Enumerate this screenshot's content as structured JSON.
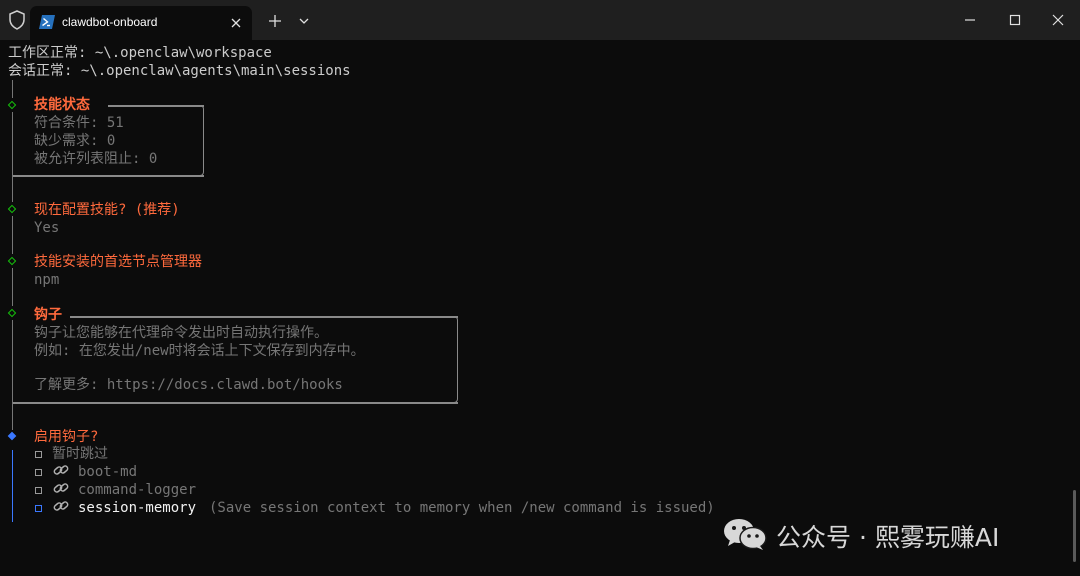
{
  "window": {
    "tab_title": "clawdbot-onboard"
  },
  "terminal": {
    "workspace_line": "工作区正常: ~\\.openclaw\\workspace",
    "sessions_line": "会话正常: ~\\.openclaw\\agents\\main\\sessions",
    "skills_status": {
      "title": "技能状态",
      "lines": [
        "符合条件: 51",
        "缺少需求: 0",
        "被允许列表阻止: 0"
      ]
    },
    "configure_skills": {
      "question": "现在配置技能? (推荐)",
      "answer": "Yes"
    },
    "node_manager": {
      "question": "技能安装的首选节点管理器",
      "answer": "npm"
    },
    "hooks": {
      "title": "钩子",
      "lines": [
        "钩子让您能够在代理命令发出时自动执行操作。",
        "例如: 在您发出/new时将会话上下文保存到内存中。",
        "",
        "了解更多: https://docs.clawd.bot/hooks"
      ]
    },
    "enable_hooks": {
      "question": "启用钩子?",
      "options": [
        {
          "label": "暂时跳过"
        },
        {
          "label": "boot-md"
        },
        {
          "label": "command-logger"
        },
        {
          "label": "session-memory",
          "hint": "(Save session context to memory when /new command is issued)"
        }
      ]
    }
  },
  "watermark": {
    "text": "公众号 · 熙雾玩赚AI"
  },
  "colors": {
    "background": "#0c0c0c",
    "titlebar": "#1f1f1f",
    "accent_orange": "#ff6a3d",
    "step_done": "#16c60c",
    "step_active": "#3b78ff",
    "dim_text": "#767676",
    "normal_text": "#cccccc"
  },
  "icons": [
    "shield-icon",
    "powershell-icon",
    "close-icon",
    "plus-icon",
    "chevron-down-icon",
    "minimize-icon",
    "maximize-icon",
    "link-icon",
    "wechat-icon"
  ]
}
